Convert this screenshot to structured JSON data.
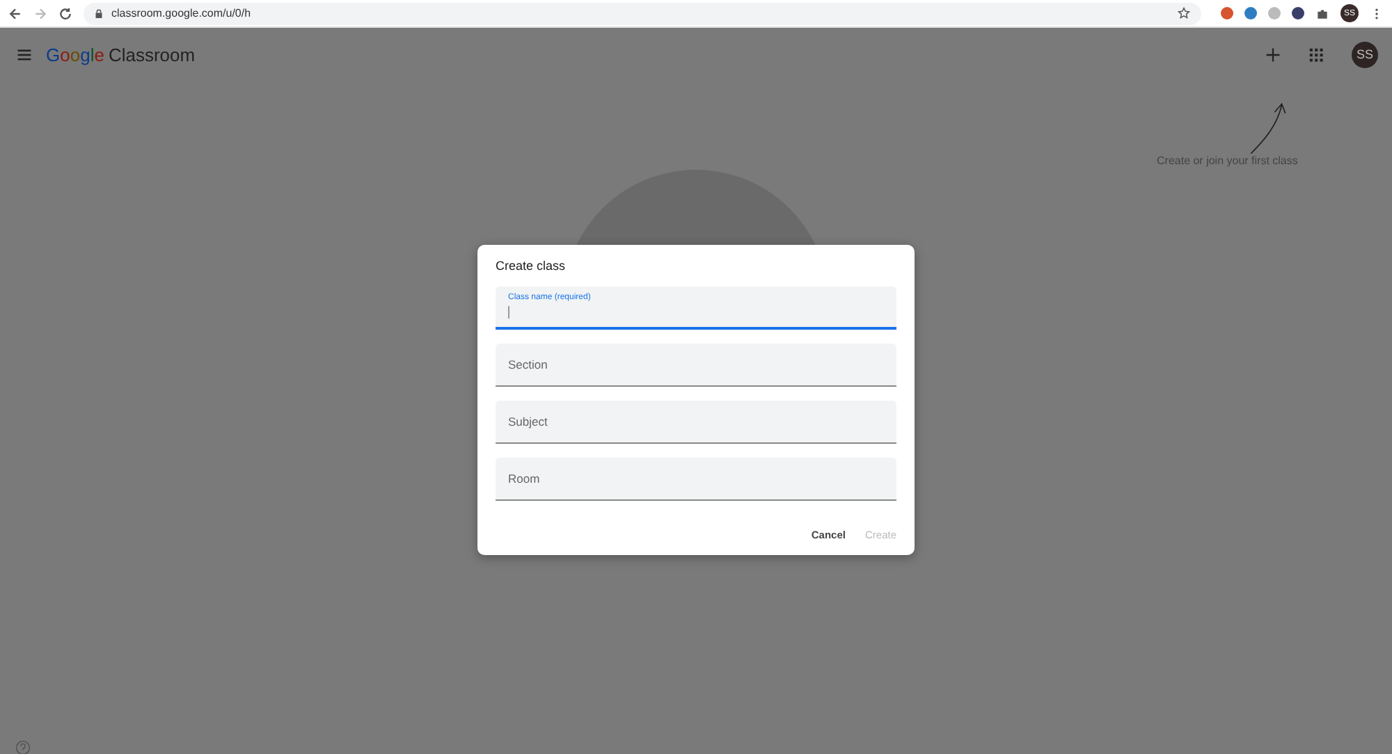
{
  "browser": {
    "url": "classroom.google.com/u/0/h",
    "avatar": "SS"
  },
  "header": {
    "logo_brand": "Google",
    "logo_product": "Classroom",
    "avatar": "SS"
  },
  "hint": {
    "text": "Create or join your first class"
  },
  "dialog": {
    "title": "Create class",
    "fields": [
      {
        "label": "Class name (required)",
        "focused": true
      },
      {
        "label": "Section",
        "focused": false
      },
      {
        "label": "Subject",
        "focused": false
      },
      {
        "label": "Room",
        "focused": false
      }
    ],
    "buttons": [
      {
        "label": "Cancel",
        "disabled": false
      },
      {
        "label": "Create",
        "disabled": true
      }
    ]
  }
}
